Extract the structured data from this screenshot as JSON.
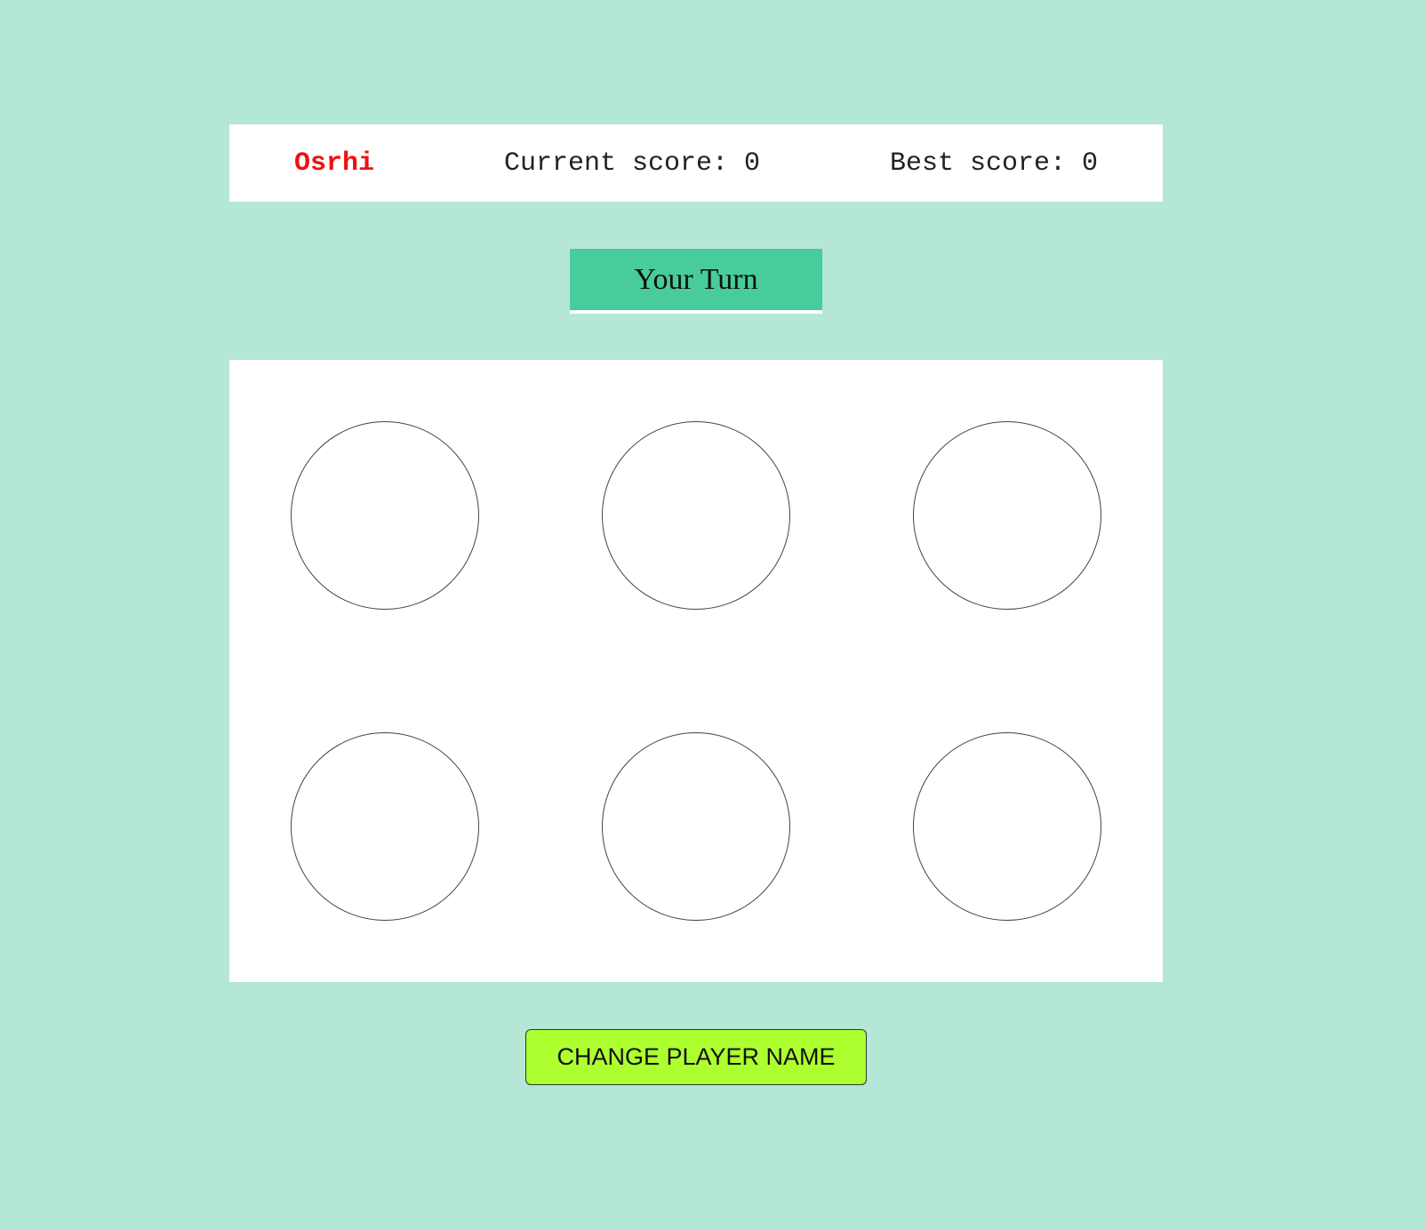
{
  "scoreboard": {
    "player_name": "Osrhi",
    "current_score_label": "Current score: 0",
    "best_score_label": "Best score: 0"
  },
  "turn_indicator": {
    "label": "Your Turn"
  },
  "board": {
    "holes": [
      "",
      "",
      "",
      "",
      "",
      ""
    ]
  },
  "buttons": {
    "change_player_name": "CHANGE PLAYER NAME"
  },
  "colors": {
    "background": "#b4e7d6",
    "turn_indicator": "#48cc9c",
    "player_name": "#ee1111",
    "button": "#adff2f"
  }
}
